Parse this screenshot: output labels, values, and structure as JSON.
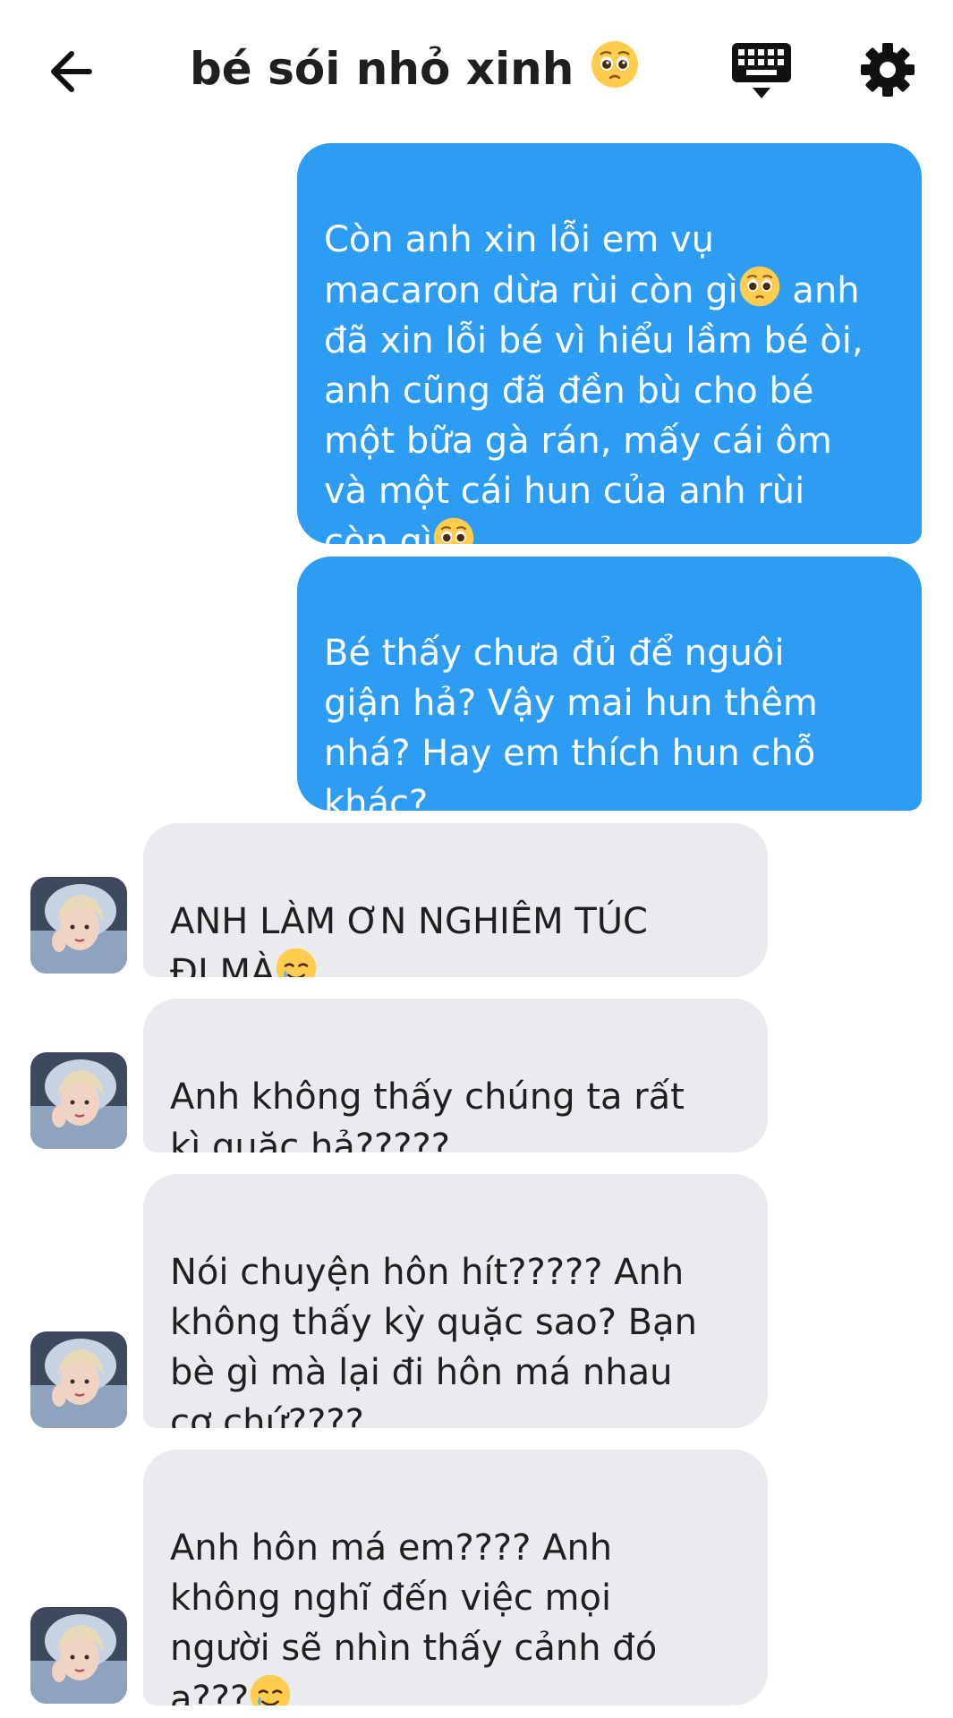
{
  "header": {
    "title": "bé sói nhỏ xinh",
    "title_emoji": "pleading-face-emoji"
  },
  "messages": [
    {
      "direction": "outgoing",
      "text": "Còn anh xin lỗi em vụ\nmacaron dừa rùi còn gì",
      "emoji": "pleading-face-emoji",
      "text_after": " anh\nđã xin lỗi bé vì hiểu lầm bé òi,\nanh cũng đã đền bù cho bé\nmột bữa gà rán, mấy cái ôm\nvà một cái hun của anh rùi\ncòn gì",
      "emoji_end": "pleading-face-emoji"
    },
    {
      "direction": "outgoing",
      "text": "Bé thấy chưa đủ để nguôi\ngiận hả? Vậy mai hun thêm\nnhá? Hay em thích hun chỗ\nkhác?"
    },
    {
      "direction": "incoming",
      "text": "ANH LÀM ƠN NGHIÊM TÚC\nĐI MÀ",
      "emoji_end": "smiling-face-with-tear-emoji"
    },
    {
      "direction": "incoming",
      "text": "Anh không thấy chúng ta rất\nkì quặc hả?????"
    },
    {
      "direction": "incoming",
      "text": "Nói chuyện hôn hít????? Anh\nkhông thấy kỳ quặc sao? Bạn\nbè gì mà lại đi hôn má nhau\ncơ chứ????"
    },
    {
      "direction": "incoming",
      "text": "Anh hôn má em???? Anh\nkhông nghĩ đến việc mọi\nngười sẽ nhìn thấy cảnh đó\nạ???",
      "emoji_end": "smiling-face-with-tear-emoji"
    }
  ],
  "icons": {
    "back": "arrow-left-icon",
    "keyboard": "keyboard-icon",
    "settings": "gear-icon",
    "avatar": "contact-avatar"
  },
  "colors": {
    "outgoing_bubble": "#2d9cf3",
    "incoming_bubble": "#e9ebee",
    "background": "#ffffff"
  }
}
